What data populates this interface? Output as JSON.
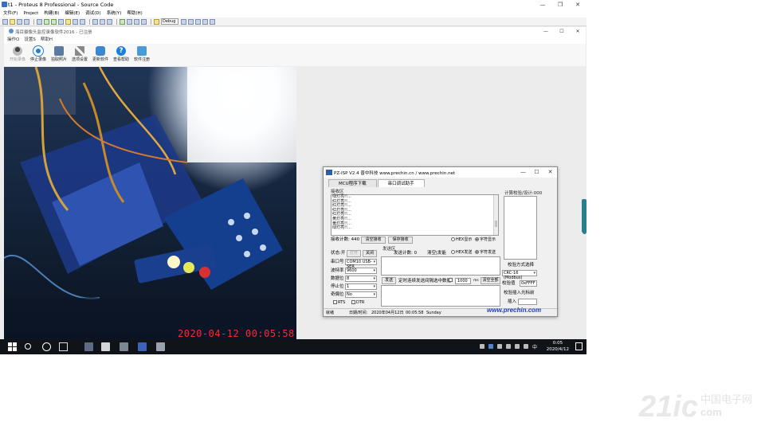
{
  "proteus": {
    "title": "t1 - Proteus 8 Professional - Source Code",
    "menu": [
      "文件(F)",
      "Project",
      "构建(B)",
      "编辑(E)",
      "调试(D)",
      "系统(Y)",
      "帮助(H)"
    ],
    "toolbar_combo": "Debug",
    "window_buttons": [
      "—",
      "❐",
      "✕"
    ]
  },
  "camera_app": {
    "title": "海目摄像头监控录像软件2016 - 已注册",
    "menu": [
      "操作O",
      "设置S",
      "帮助H"
    ],
    "window_buttons": [
      "—",
      "☐",
      "✕"
    ],
    "toolbar": [
      {
        "label": "开始录像",
        "icon": "person-camera-icon",
        "enabled": false
      },
      {
        "label": "停止录像",
        "icon": "stop-record-icon",
        "enabled": true
      },
      {
        "label": "拍取照片",
        "icon": "camera-icon",
        "enabled": true
      },
      {
        "label": "选项设置",
        "icon": "tools-icon",
        "enabled": true
      },
      {
        "label": "更新软件",
        "icon": "update-icon",
        "enabled": true
      },
      {
        "label": "查看帮助",
        "icon": "help-icon",
        "enabled": true
      },
      {
        "label": "软件注册",
        "icon": "register-icon",
        "enabled": true
      }
    ],
    "video_timestamp": "2020-04-12 00:05:58"
  },
  "isp": {
    "title": "PZ-ISP V2.4 普中科技  www.prechin.cn / www.prechin.net",
    "window_buttons": [
      "—",
      "☐",
      "✕"
    ],
    "tabs": [
      "MCU程序下载",
      "串口调试助手"
    ],
    "recv_area_label": "接收区",
    "recv_lines": [
      "绿灯亮!!...",
      "红灯亮!!...",
      "红灯亮!!...",
      "红灯亮!!...",
      "红灯亮!!...",
      "黄灯亮!!...",
      "黄灯亮!!...",
      "绿灯亮!!..."
    ],
    "recv_count_label": "接收计数: 440",
    "clear_recv": "清空接收",
    "save_recv": "保存接收",
    "recv_hex": "HEX显示",
    "recv_char": "字符显示",
    "checksum_label": "计算校验/设计:000",
    "status_label": "状态:开",
    "open_btn": "打开",
    "close_btn": "关闭",
    "send_area_label": "发送区",
    "send_count_label": "发送计数: 0",
    "clear_send": "清空|发能",
    "send_hex": "HEX发送",
    "send_char": "字符发送",
    "port_label": "串口号",
    "port_value": "COM10 USB-SER",
    "baud_label": "波特率",
    "baud_value": "9600",
    "data_label": "数据位",
    "data_value": "8",
    "stop_label": "停止位",
    "stop_value": "1",
    "parity_label": "奇偶位",
    "parity_value": "No",
    "rts": "RTS",
    "dtr": "DTR",
    "send_btn": "发送",
    "timed_send": "定时连续发送间隔",
    "timed_select": "选中数据",
    "interval_value": "1000",
    "interval_unit": "ms",
    "clear_all": "清空全部",
    "check_method_label": "校验方式选择",
    "check_method_value": "CRC-16 (Modbus)",
    "check_value_label": "校验值",
    "check_value": "0xFFFF",
    "insert_label": "校验插入光标前",
    "insert_btn": "插入",
    "status_state": "就绪",
    "date_label": "日期/时间:",
    "date_value": "2020年04月12日",
    "time_value": "00:05:58",
    "weekday": "Sunday",
    "logo": "www.prechin.com"
  },
  "taskbar": {
    "lang": "中",
    "time": "0:05",
    "date": "2020/4/12"
  },
  "watermark": {
    "brand": "21ic",
    "cn": "中国电子网",
    "domain": "com"
  }
}
